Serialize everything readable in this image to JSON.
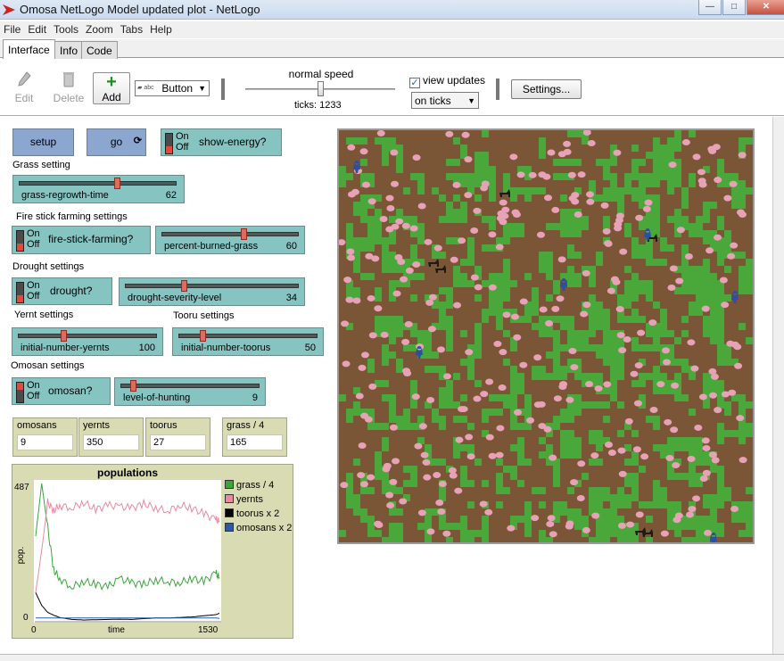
{
  "window": {
    "title": "Omosa NetLogo Model updated plot - NetLogo",
    "minimize": "—",
    "maximize": "□",
    "close": "✕"
  },
  "menu": [
    "File",
    "Edit",
    "Tools",
    "Zoom",
    "Tabs",
    "Help"
  ],
  "tabs": [
    "Interface",
    "Info",
    "Code"
  ],
  "toolbar": {
    "edit": "Edit",
    "delete": "Delete",
    "add": "Add",
    "widget_type": "Button",
    "speed_label": "normal speed",
    "speed_fraction": 0.5,
    "ticks": "ticks: 1233",
    "view_updates": "view updates",
    "view_updates_checked": true,
    "update_mode": "on ticks",
    "settings": "Settings..."
  },
  "buttons": {
    "setup": "setup",
    "go": "go"
  },
  "switches": {
    "show_energy": {
      "name": "show-energy?",
      "on": "On",
      "off": "Off",
      "value": false
    },
    "fire_stick": {
      "name": "fire-stick-farming?",
      "on": "On",
      "off": "Off",
      "value": false
    },
    "drought": {
      "name": "drought?",
      "on": "On",
      "off": "Off",
      "value": false
    },
    "omosan": {
      "name": "omosan?",
      "on": "On",
      "off": "Off",
      "value": true
    }
  },
  "labels": {
    "grass": "Grass setting",
    "fire": "Fire stick farming settings",
    "drought": "Drought settings",
    "yernt": "Yernt settings",
    "tooru": "Tooru settings",
    "omosan": "Omosan settings"
  },
  "sliders": {
    "grass_regrowth": {
      "name": "grass-regrowth-time",
      "value": "62",
      "fraction": 0.62
    },
    "percent_burned": {
      "name": "percent-burned-grass",
      "value": "60",
      "fraction": 0.6
    },
    "drought_severity": {
      "name": "drought-severity-level",
      "value": "34",
      "fraction": 0.34
    },
    "init_yernts": {
      "name": "initial-number-yernts",
      "value": "100",
      "fraction": 0.33
    },
    "init_toorus": {
      "name": "initial-number-toorus",
      "value": "50",
      "fraction": 0.17
    },
    "hunting": {
      "name": "level-of-hunting",
      "value": "9",
      "fraction": 0.09
    }
  },
  "monitors": [
    {
      "label": "omosans",
      "value": "9"
    },
    {
      "label": "yernts",
      "value": "350"
    },
    {
      "label": "toorus",
      "value": "27"
    },
    {
      "label": "grass / 4",
      "value": "165"
    }
  ],
  "plot": {
    "title": "populations",
    "ymax": "487",
    "ymin": "0",
    "xmin": "0",
    "xmax": "1530",
    "xlabel": "time",
    "ylabel": "pop.",
    "legend": [
      {
        "name": "grass / 4",
        "color": "#3aa53a"
      },
      {
        "name": "yernts",
        "color": "#e78aa2"
      },
      {
        "name": "toorus x 2",
        "color": "#000000"
      },
      {
        "name": "omosans x 2",
        "color": "#2b59a8"
      }
    ]
  },
  "chart_data": {
    "type": "line",
    "title": "populations",
    "xlabel": "time",
    "ylabel": "pop.",
    "xlim": [
      0,
      1530
    ],
    "ylim": [
      0,
      487
    ],
    "x": [
      0,
      50,
      100,
      150,
      200,
      300,
      400,
      500,
      600,
      700,
      800,
      900,
      1000,
      1100,
      1200,
      1300,
      1400,
      1500,
      1530
    ],
    "series": [
      {
        "name": "grass / 4",
        "values": [
          300,
          487,
          330,
          180,
          150,
          120,
          140,
          130,
          120,
          150,
          135,
          130,
          145,
          140,
          135,
          150,
          140,
          170,
          150
        ]
      },
      {
        "name": "yernts",
        "values": [
          100,
          250,
          420,
          390,
          410,
          400,
          420,
          395,
          410,
          405,
          400,
          415,
          400,
          390,
          410,
          400,
          380,
          360,
          350
        ]
      },
      {
        "name": "toorus x 2",
        "values": [
          100,
          55,
          30,
          20,
          12,
          5,
          3,
          4,
          5,
          6,
          5,
          8,
          10,
          10,
          12,
          14,
          18,
          22,
          27
        ]
      },
      {
        "name": "omosans x 2",
        "values": [
          10,
          10,
          10,
          10,
          10,
          10,
          10,
          10,
          10,
          10,
          10,
          10,
          10,
          10,
          10,
          10,
          10,
          10,
          9
        ]
      }
    ]
  },
  "world": {
    "soil_color": "#7a5637",
    "grass_color": "#4aa83b",
    "yernt_color": "#e8a2b7",
    "tooru_color": "#1e1a16",
    "omosan_color": "#2d4ea5"
  }
}
